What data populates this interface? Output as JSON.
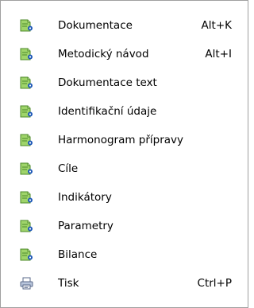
{
  "menu": {
    "items": [
      {
        "label": "Dokumentace",
        "shortcut": "Alt+K",
        "icon": "document-settings-icon"
      },
      {
        "label": "Metodický návod",
        "shortcut": "Alt+I",
        "icon": "document-settings-icon"
      },
      {
        "label": "Dokumentace text",
        "shortcut": "",
        "icon": "document-settings-icon"
      },
      {
        "label": "Identifikační údaje",
        "shortcut": "",
        "icon": "document-settings-icon"
      },
      {
        "label": "Harmonogram přípravy",
        "shortcut": "",
        "icon": "document-settings-icon"
      },
      {
        "label": "Cíle",
        "shortcut": "",
        "icon": "document-settings-icon"
      },
      {
        "label": "Indikátory",
        "shortcut": "",
        "icon": "document-settings-icon"
      },
      {
        "label": "Parametry",
        "shortcut": "",
        "icon": "document-settings-icon"
      },
      {
        "label": "Bilance",
        "shortcut": "",
        "icon": "document-settings-icon"
      },
      {
        "label": "Tisk",
        "shortcut": "Ctrl+P",
        "icon": "printer-icon"
      }
    ]
  },
  "colors": {
    "icon_page_green": "#7ec44a",
    "icon_gear_blue": "#1d58b8",
    "hover_background": "#e5f1fb",
    "border": "#a0a0a0"
  }
}
